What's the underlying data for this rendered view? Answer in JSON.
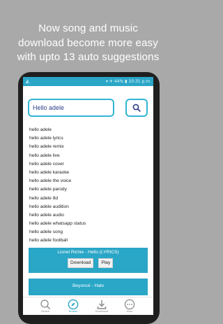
{
  "promo": {
    "line1": "Now song and music",
    "line2": "download become more easy",
    "line3": "with upto 13 auto suggestions"
  },
  "status_bar": {
    "left_icon": "app-notification-icon",
    "network": "44%",
    "time": "10:31 p.m."
  },
  "search": {
    "value": "Hello adele",
    "button_icon": "search-icon"
  },
  "suggestions": [
    "hello adele",
    "hello adele lyrics",
    "hello adele remix",
    "hello adele live",
    "hello adele cover",
    "hello adele karaoke",
    "hello adele the voice",
    "hello adele parody",
    "hello adele 8d",
    "hello adele audition",
    "hello adele audio",
    "hello adele whatsapp status",
    "hello adele song",
    "hello adele football"
  ],
  "results": [
    {
      "title": "Lionel Richie - Hello (LYRICS)",
      "download_label": "Download",
      "play_label": "Play"
    },
    {
      "title": "Beyoncé - Halo"
    }
  ],
  "bottom_nav": [
    {
      "label": "Search",
      "icon": "search-icon"
    },
    {
      "label": "Browse",
      "icon": "compass-icon"
    },
    {
      "label": "Downloads",
      "icon": "download-icon"
    },
    {
      "label": "More",
      "icon": "more-icon"
    }
  ],
  "colors": {
    "accent": "#2aa6c7",
    "background": "#a9a9a9",
    "query_text": "#2e3f89"
  }
}
